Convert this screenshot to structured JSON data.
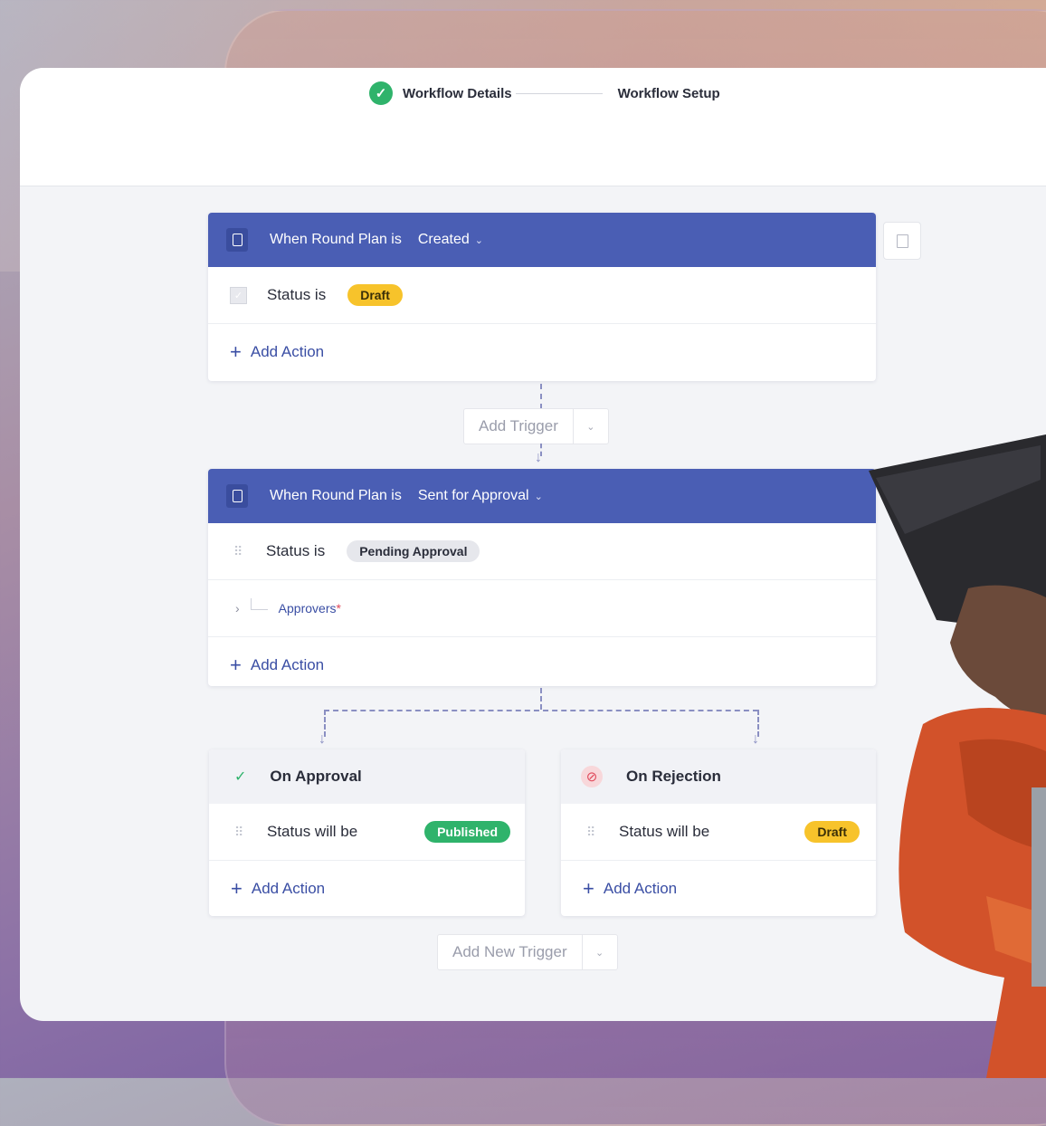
{
  "stepper": {
    "step1": "Workflow Details",
    "step2": "Workflow Setup"
  },
  "trigger1": {
    "prefix": "When Round Plan is",
    "state": "Created",
    "status_label": "Status is",
    "status_value": "Draft",
    "add_action": "Add Action"
  },
  "add_trigger": {
    "label": "Add Trigger"
  },
  "trigger2": {
    "prefix": "When Round Plan is",
    "state": "Sent for Approval",
    "status_label": "Status is",
    "status_value": "Pending Approval",
    "approvers_label": "Approvers",
    "required_mark": "*",
    "add_action": "Add Action"
  },
  "on_approval": {
    "title": "On Approval",
    "status_label": "Status will be",
    "status_value": "Published",
    "add_action": "Add Action"
  },
  "on_rejection": {
    "title": "On Rejection",
    "status_label": "Status will be",
    "status_value": "Draft",
    "add_action": "Add Action"
  },
  "add_new_trigger": {
    "label": "Add New Trigger"
  },
  "colors": {
    "header_blue": "#4a5eb4",
    "success_green": "#2fb36b",
    "draft_yellow": "#f7c32b",
    "link_blue": "#3a4ea4"
  },
  "icons": [
    "check-circle-icon",
    "document-icon",
    "chevron-down-icon",
    "trash-icon",
    "plus-icon",
    "drag-grip-icon",
    "checkbox-icon",
    "chevron-right-icon",
    "check-icon",
    "ban-icon",
    "arrow-down-icon"
  ]
}
